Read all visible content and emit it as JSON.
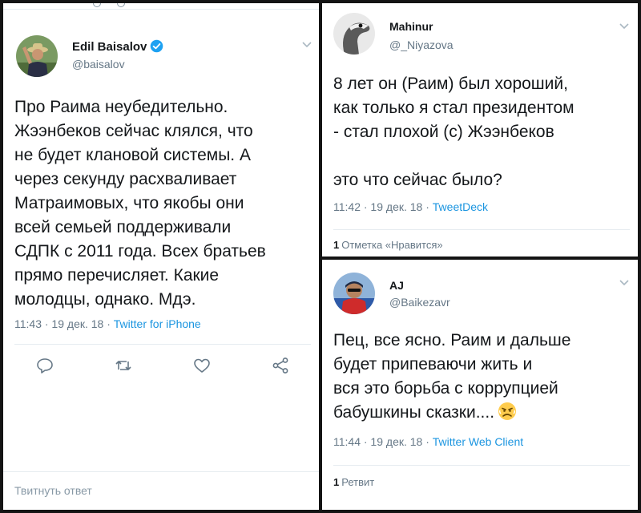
{
  "tweets": [
    {
      "display_name": "Edil Baisalov",
      "handle": "@baisalov",
      "verified": true,
      "text": "Про Раима неубедительно.\nЖээнбеков сейчас клялся, что\nне будет клановой системы. А\nчерез секунду расхваливает\nМатраимовых, что якобы они\nвсей семьей поддерживали\nСДПК с 2011 года. Всех братьев\nпрямо перечисляет. Какие\nмолодцы, однако. Мдэ.",
      "time": "11:43 · 19 дек. 18 · ",
      "source": "Twitter for iPhone",
      "reply_prompt": "Твитнуть ответ",
      "icons": [
        "reply-icon",
        "retweet-icon",
        "like-icon",
        "share-icon"
      ]
    },
    {
      "display_name": "Mahinur",
      "handle": "@_Niyazova",
      "text": "8 лет он (Раим) был хороший,\nкак только я стал президентом\n- стал плохой (с) Жээнбеков\n\nэто что сейчас было?",
      "time": "11:42 · 19 дек. 18 · ",
      "source": "TweetDeck",
      "stat_count": "1",
      "stat_label": "Отметка «Нравится»"
    },
    {
      "display_name": "AJ",
      "handle": "@Baikezavr",
      "text": "Пец, все ясно. Раим и дальше\nбудет припеваючи жить и\nвся это борьба с коррупцией\nбабушкины сказки....",
      "emoji": "angry-face-emoji",
      "time": "11:44 · 19 дек. 18 · ",
      "source": "Twitter Web Client",
      "stat_count": "1",
      "stat_label": "Ретвит"
    }
  ],
  "colors": {
    "link": "#1b95e0",
    "muted": "#657786",
    "text": "#14171a",
    "divider": "#e6ecf0",
    "background": "#141414"
  }
}
